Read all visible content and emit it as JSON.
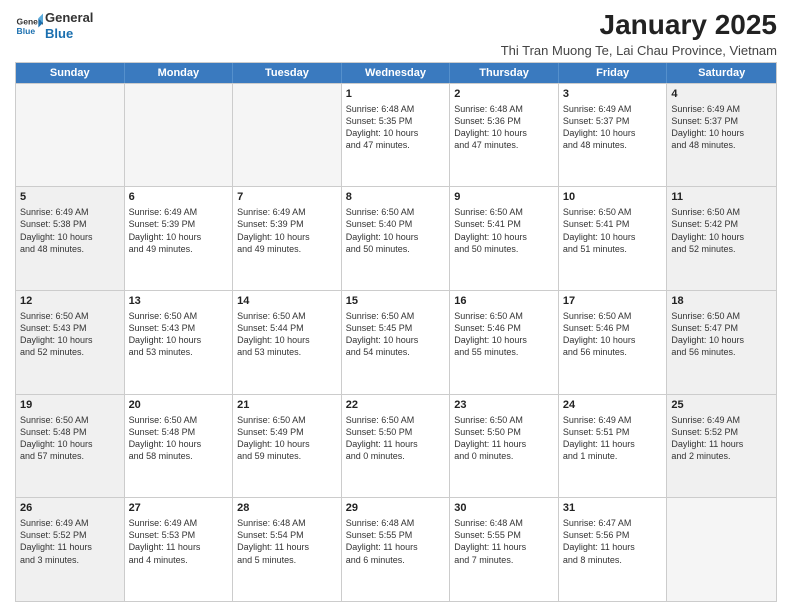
{
  "logo": {
    "general": "General",
    "blue": "Blue"
  },
  "header": {
    "title": "January 2025",
    "subtitle": "Thi Tran Muong Te, Lai Chau Province, Vietnam"
  },
  "days": [
    "Sunday",
    "Monday",
    "Tuesday",
    "Wednesday",
    "Thursday",
    "Friday",
    "Saturday"
  ],
  "rows": [
    [
      {
        "day": "",
        "content": "",
        "empty": true
      },
      {
        "day": "",
        "content": "",
        "empty": true
      },
      {
        "day": "",
        "content": "",
        "empty": true
      },
      {
        "day": "1",
        "content": "Sunrise: 6:48 AM\nSunset: 5:35 PM\nDaylight: 10 hours\nand 47 minutes."
      },
      {
        "day": "2",
        "content": "Sunrise: 6:48 AM\nSunset: 5:36 PM\nDaylight: 10 hours\nand 47 minutes."
      },
      {
        "day": "3",
        "content": "Sunrise: 6:49 AM\nSunset: 5:37 PM\nDaylight: 10 hours\nand 48 minutes."
      },
      {
        "day": "4",
        "content": "Sunrise: 6:49 AM\nSunset: 5:37 PM\nDaylight: 10 hours\nand 48 minutes.",
        "shaded": true
      }
    ],
    [
      {
        "day": "5",
        "content": "Sunrise: 6:49 AM\nSunset: 5:38 PM\nDaylight: 10 hours\nand 48 minutes.",
        "shaded": true
      },
      {
        "day": "6",
        "content": "Sunrise: 6:49 AM\nSunset: 5:39 PM\nDaylight: 10 hours\nand 49 minutes."
      },
      {
        "day": "7",
        "content": "Sunrise: 6:49 AM\nSunset: 5:39 PM\nDaylight: 10 hours\nand 49 minutes."
      },
      {
        "day": "8",
        "content": "Sunrise: 6:50 AM\nSunset: 5:40 PM\nDaylight: 10 hours\nand 50 minutes."
      },
      {
        "day": "9",
        "content": "Sunrise: 6:50 AM\nSunset: 5:41 PM\nDaylight: 10 hours\nand 50 minutes."
      },
      {
        "day": "10",
        "content": "Sunrise: 6:50 AM\nSunset: 5:41 PM\nDaylight: 10 hours\nand 51 minutes."
      },
      {
        "day": "11",
        "content": "Sunrise: 6:50 AM\nSunset: 5:42 PM\nDaylight: 10 hours\nand 52 minutes.",
        "shaded": true
      }
    ],
    [
      {
        "day": "12",
        "content": "Sunrise: 6:50 AM\nSunset: 5:43 PM\nDaylight: 10 hours\nand 52 minutes.",
        "shaded": true
      },
      {
        "day": "13",
        "content": "Sunrise: 6:50 AM\nSunset: 5:43 PM\nDaylight: 10 hours\nand 53 minutes."
      },
      {
        "day": "14",
        "content": "Sunrise: 6:50 AM\nSunset: 5:44 PM\nDaylight: 10 hours\nand 53 minutes."
      },
      {
        "day": "15",
        "content": "Sunrise: 6:50 AM\nSunset: 5:45 PM\nDaylight: 10 hours\nand 54 minutes."
      },
      {
        "day": "16",
        "content": "Sunrise: 6:50 AM\nSunset: 5:46 PM\nDaylight: 10 hours\nand 55 minutes."
      },
      {
        "day": "17",
        "content": "Sunrise: 6:50 AM\nSunset: 5:46 PM\nDaylight: 10 hours\nand 56 minutes."
      },
      {
        "day": "18",
        "content": "Sunrise: 6:50 AM\nSunset: 5:47 PM\nDaylight: 10 hours\nand 56 minutes.",
        "shaded": true
      }
    ],
    [
      {
        "day": "19",
        "content": "Sunrise: 6:50 AM\nSunset: 5:48 PM\nDaylight: 10 hours\nand 57 minutes.",
        "shaded": true
      },
      {
        "day": "20",
        "content": "Sunrise: 6:50 AM\nSunset: 5:48 PM\nDaylight: 10 hours\nand 58 minutes."
      },
      {
        "day": "21",
        "content": "Sunrise: 6:50 AM\nSunset: 5:49 PM\nDaylight: 10 hours\nand 59 minutes."
      },
      {
        "day": "22",
        "content": "Sunrise: 6:50 AM\nSunset: 5:50 PM\nDaylight: 11 hours\nand 0 minutes."
      },
      {
        "day": "23",
        "content": "Sunrise: 6:50 AM\nSunset: 5:50 PM\nDaylight: 11 hours\nand 0 minutes."
      },
      {
        "day": "24",
        "content": "Sunrise: 6:49 AM\nSunset: 5:51 PM\nDaylight: 11 hours\nand 1 minute."
      },
      {
        "day": "25",
        "content": "Sunrise: 6:49 AM\nSunset: 5:52 PM\nDaylight: 11 hours\nand 2 minutes.",
        "shaded": true
      }
    ],
    [
      {
        "day": "26",
        "content": "Sunrise: 6:49 AM\nSunset: 5:52 PM\nDaylight: 11 hours\nand 3 minutes.",
        "shaded": true
      },
      {
        "day": "27",
        "content": "Sunrise: 6:49 AM\nSunset: 5:53 PM\nDaylight: 11 hours\nand 4 minutes."
      },
      {
        "day": "28",
        "content": "Sunrise: 6:48 AM\nSunset: 5:54 PM\nDaylight: 11 hours\nand 5 minutes."
      },
      {
        "day": "29",
        "content": "Sunrise: 6:48 AM\nSunset: 5:55 PM\nDaylight: 11 hours\nand 6 minutes."
      },
      {
        "day": "30",
        "content": "Sunrise: 6:48 AM\nSunset: 5:55 PM\nDaylight: 11 hours\nand 7 minutes."
      },
      {
        "day": "31",
        "content": "Sunrise: 6:47 AM\nSunset: 5:56 PM\nDaylight: 11 hours\nand 8 minutes."
      },
      {
        "day": "",
        "content": "",
        "empty": true
      }
    ]
  ]
}
